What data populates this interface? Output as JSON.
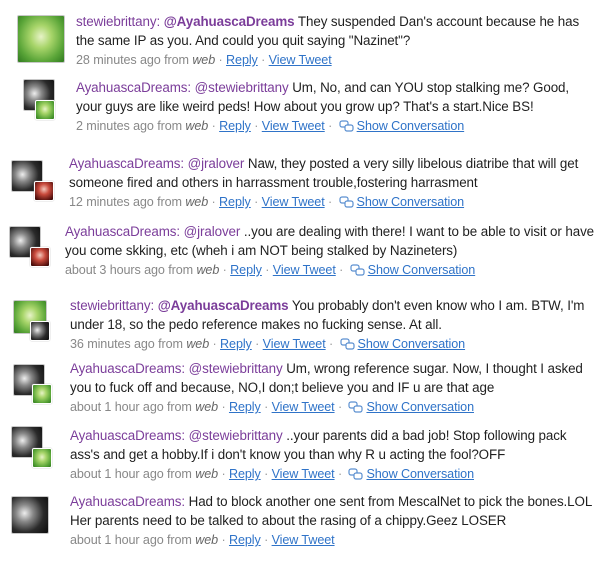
{
  "tweets": [
    {
      "user": "stewiebrittany:",
      "reply_to": "@AyahuascaDreams",
      "reply_bold": true,
      "text": "They suspended Dan's account because he has the same IP as you. And could you quit saying \"Nazinet\"?",
      "time": "28 minutes ago from",
      "via": "web",
      "reply": "Reply",
      "view": "View Tweet",
      "conversation": "",
      "avatar": "stewie",
      "sub": ""
    },
    {
      "user": "AyahuascaDreams:",
      "reply_to": "@stewiebrittany",
      "reply_bold": false,
      "text": "Um, No, and can YOU stop stalking me? Good, your guys are like weird peds! How about you grow up? That's a start.Nice BS!",
      "time": "2 minutes ago from",
      "via": "web",
      "reply": "Reply",
      "view": "View Tweet",
      "conversation": "Show Conversation",
      "avatar": "ayah",
      "sub": "stewie"
    },
    {
      "user": "AyahuascaDreams:",
      "reply_to": "@jralover",
      "reply_bold": false,
      "text": "Naw, they posted a very silly libelous diatribe that will get someone fired and others in harrassment trouble,fostering harrasment",
      "time": "12 minutes ago from",
      "via": "web",
      "reply": "Reply",
      "view": "View Tweet",
      "conversation": "Show Conversation",
      "avatar": "ayah",
      "sub": "jra"
    },
    {
      "user": "AyahuascaDreams:",
      "reply_to": "@jralover",
      "reply_bold": false,
      "text": "..you are dealing with there! I want to be able to visit or have you come skking, etc (wheh i am NOT being stalked by Nazineters)",
      "time": "about 3 hours ago from",
      "via": "web",
      "reply": "Reply",
      "view": "View Tweet",
      "conversation": "Show Conversation",
      "avatar": "ayah",
      "sub": "jra"
    },
    {
      "user": "stewiebrittany:",
      "reply_to": "@AyahuascaDreams",
      "reply_bold": true,
      "text": "You probably don't even know who I am. BTW, I'm under 18, so the pedo reference makes no fucking sense. At all.",
      "time": "36 minutes ago from",
      "via": "web",
      "reply": "Reply",
      "view": "View Tweet",
      "conversation": "Show Conversation",
      "avatar": "stewie",
      "sub": "ayah"
    },
    {
      "user": "AyahuascaDreams:",
      "reply_to": "@stewiebrittany",
      "reply_bold": false,
      "text": "Um, wrong reference sugar. Now, I thought I asked you to fuck off and because, NO,I don;t believe you and IF u are that age",
      "time": "about 1 hour ago from",
      "via": "web",
      "reply": "Reply",
      "view": "View Tweet",
      "conversation": "Show Conversation",
      "avatar": "ayah",
      "sub": "stewie"
    },
    {
      "user": "AyahuascaDreams:",
      "reply_to": "@stewiebrittany",
      "reply_bold": false,
      "text": "..your parents did a bad job! Stop following pack ass's and get a hobby.If i don't know you than why R u acting the fool?OFF",
      "time": "about 1 hour ago from",
      "via": "web",
      "reply": "Reply",
      "view": "View Tweet",
      "conversation": "Show Conversation",
      "avatar": "ayah",
      "sub": "stewie"
    },
    {
      "user": "AyahuascaDreams:",
      "reply_to": "",
      "reply_bold": false,
      "text": "Had to block another one sent from MescalNet to pick the bones.LOL Her parents need to be talked to about the rasing of a chippy.Geez LOSER",
      "time": "about 1 hour ago from",
      "via": "web",
      "reply": "Reply",
      "view": "View Tweet",
      "conversation": "",
      "avatar": "ayah",
      "sub": ""
    }
  ],
  "separator": "·"
}
